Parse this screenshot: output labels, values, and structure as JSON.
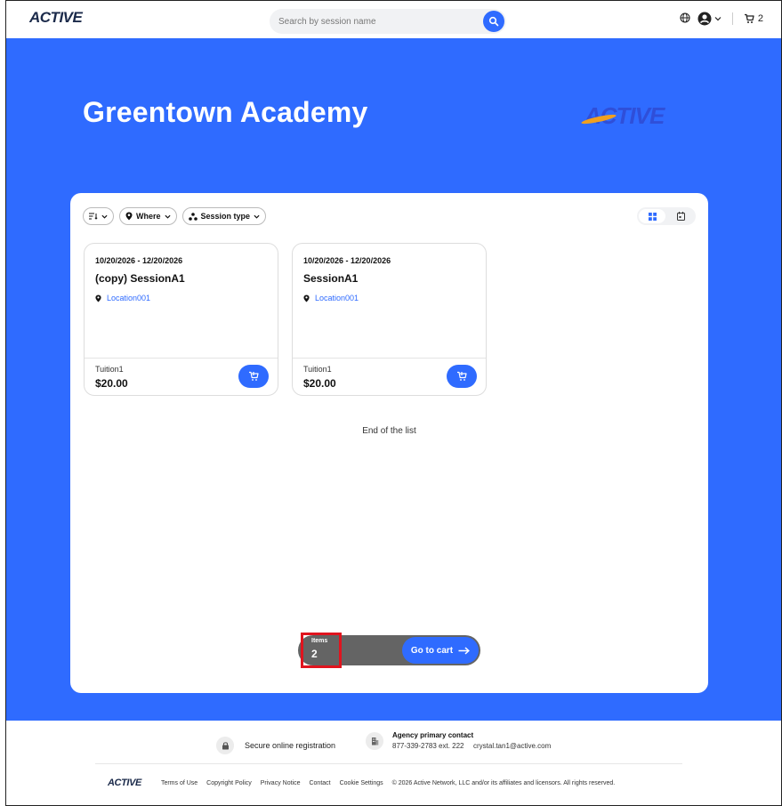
{
  "header": {
    "brand": "ACTIVE",
    "search_placeholder": "Search by session name",
    "cart_count": "2"
  },
  "hero": {
    "title": "Greentown Academy",
    "logo": "ACTIVE"
  },
  "filters": {
    "sort_icon": "sort-icon",
    "where_label": "Where",
    "session_type_label": "Session type"
  },
  "sessions": [
    {
      "dates": "10/20/2026 - 12/20/2026",
      "name": "(copy) SessionA1",
      "location": "Location001",
      "fee_name": "Tuition1",
      "price": "$20.00"
    },
    {
      "dates": "10/20/2026 - 12/20/2026",
      "name": "SessionA1",
      "location": "Location001",
      "fee_name": "Tuition1",
      "price": "$20.00"
    }
  ],
  "end_of_list": "End of the list",
  "cart_bar": {
    "items_label": "Items",
    "items_count": "2",
    "go_to_cart": "Go to cart"
  },
  "footer": {
    "secure": "Secure online registration",
    "contact_title": "Agency primary contact",
    "contact_phone": "877-339-2783 ext. 222",
    "contact_email": "crystal.tan1@active.com",
    "logo": "ACTIVE",
    "links": [
      "Terms of Use",
      "Copyright Policy",
      "Privacy Notice",
      "Contact",
      "Cookie Settings"
    ],
    "copyright": "© 2026 Active Network, LLC and/or its affiliates and licensors. All rights reserved."
  },
  "colors": {
    "primary": "#2f6bff",
    "hero_bg": "#2f6bff",
    "cart_bar_bg": "#646464",
    "highlight": "#e0141e"
  }
}
